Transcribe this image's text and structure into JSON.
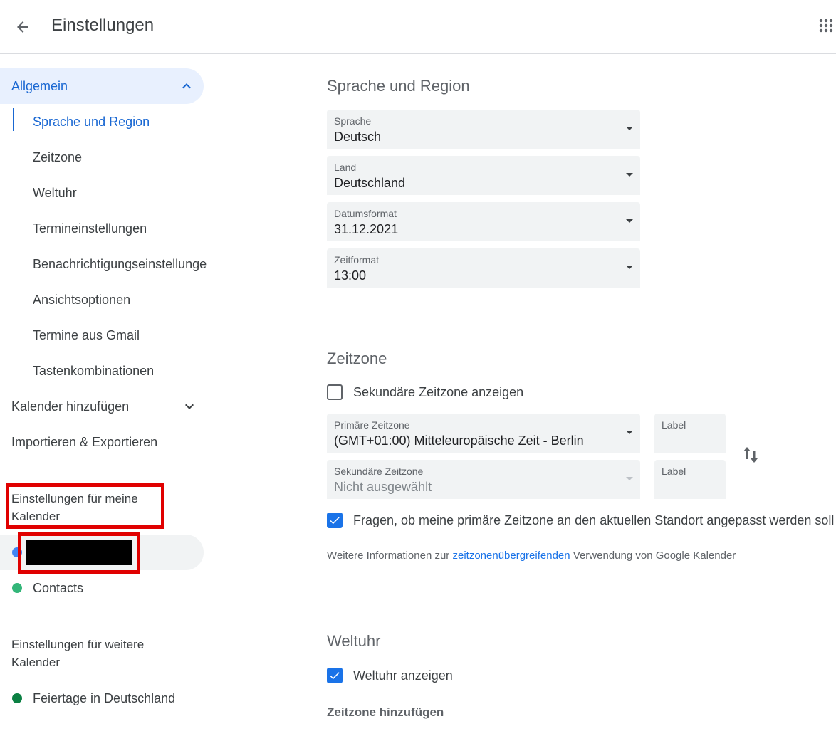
{
  "header": {
    "title": "Einstellungen"
  },
  "sidebar": {
    "general": {
      "label": "Allgemein",
      "items": [
        "Sprache und Region",
        "Zeitzone",
        "Weltuhr",
        "Termineinstellungen",
        "Benachrichtigungseinstellungen",
        "Ansichtsoptionen",
        "Termine aus Gmail",
        "Tastenkombinationen"
      ]
    },
    "add_calendar": "Kalender hinzufügen",
    "import_export": "Importieren & Exportieren",
    "my_calendars": {
      "heading": "Einstellungen für meine Kalender",
      "calendars": [
        {
          "name": "",
          "color": "#4285f4",
          "redacted": true
        },
        {
          "name": "Contacts",
          "color": "#33b679"
        }
      ]
    },
    "other_calendars": {
      "heading": "Einstellungen für weitere Kalender",
      "calendars": [
        {
          "name": "Feiertage in Deutschland",
          "color": "#0b8043"
        }
      ]
    }
  },
  "main": {
    "language_region": {
      "title": "Sprache und Region",
      "fields": [
        {
          "label": "Sprache",
          "value": "Deutsch"
        },
        {
          "label": "Land",
          "value": "Deutschland"
        },
        {
          "label": "Datumsformat",
          "value": "31.12.2021"
        },
        {
          "label": "Zeitformat",
          "value": "13:00"
        }
      ]
    },
    "timezone": {
      "title": "Zeitzone",
      "show_secondary": {
        "label": "Sekundäre Zeitzone anzeigen",
        "checked": false
      },
      "primary": {
        "label": "Primäre Zeitzone",
        "value": "(GMT+01:00) Mitteleuropäische Zeit - Berlin"
      },
      "secondary": {
        "label": "Sekundäre Zeitzone",
        "value": "Nicht ausgewählt"
      },
      "primary_label_field": "Label",
      "secondary_label_field": "Label",
      "ask_update": {
        "label": "Fragen, ob meine primäre Zeitzone an den aktuellen Standort angepasst werden soll",
        "checked": true
      },
      "info_before": "Weitere Informationen zur ",
      "info_link": "zeitzonenübergreifenden",
      "info_after": " Verwendung von Google Kalender"
    },
    "world_clock": {
      "title": "Weltuhr",
      "show": {
        "label": "Weltuhr anzeigen",
        "checked": true
      },
      "add_timezone": "Zeitzone hinzufügen"
    }
  },
  "colors": {
    "accent": "#1a73e8",
    "active_nav": "#1967d2",
    "annotation_red": "#e00000"
  }
}
